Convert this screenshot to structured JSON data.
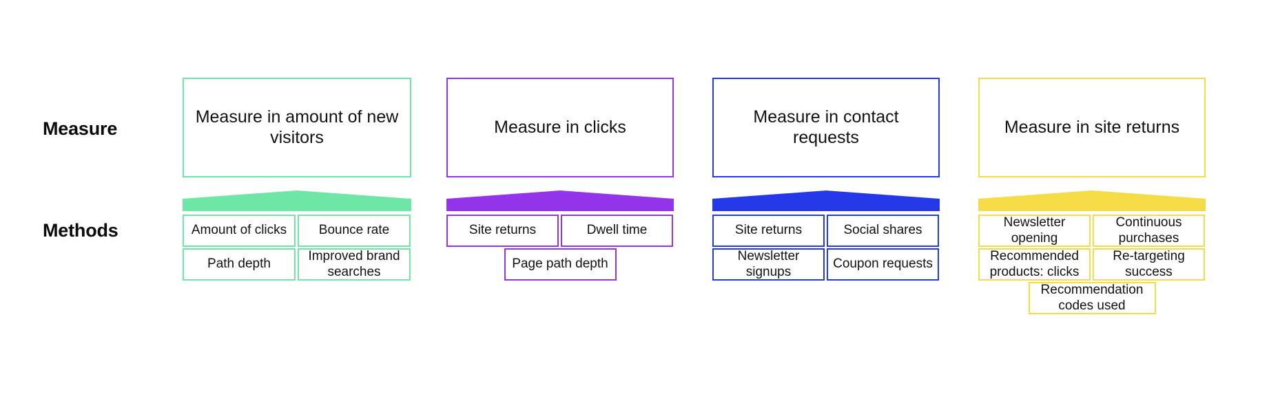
{
  "diagram": {
    "title": "Measure and Methods Funnel Diagram",
    "background_color": "#ffffff",
    "rows": {
      "measure_label": "Measure",
      "methods_label": "Methods"
    },
    "columns": [
      {
        "id": "new-visitors",
        "color": "#6EE7A6",
        "measure": "Measure in amount of new visitors",
        "arrow_icon": "funnel-chevron-icon",
        "method_rows": [
          {
            "centered": false,
            "boxes": [
              "Amount of clicks",
              "Bounce rate"
            ]
          },
          {
            "centered": false,
            "boxes": [
              "Path depth",
              "Improved brand searches"
            ]
          }
        ]
      },
      {
        "id": "clicks",
        "color": "#9333EA",
        "measure": "Measure in clicks",
        "arrow_icon": "funnel-chevron-icon",
        "method_rows": [
          {
            "centered": false,
            "boxes": [
              "Site returns",
              "Dwell time"
            ]
          },
          {
            "centered": true,
            "boxes": [
              "Page path depth"
            ]
          }
        ]
      },
      {
        "id": "contact-requests",
        "color": "#2538E8",
        "measure": "Measure in contact requests",
        "arrow_icon": "funnel-chevron-icon",
        "method_rows": [
          {
            "centered": false,
            "boxes": [
              "Site returns",
              "Social shares"
            ]
          },
          {
            "centered": false,
            "boxes": [
              "Newsletter signups",
              "Coupon requests"
            ]
          }
        ]
      },
      {
        "id": "site-returns",
        "color": "#F5DB45",
        "measure": "Measure in site returns",
        "arrow_icon": "funnel-chevron-icon",
        "method_rows": [
          {
            "centered": false,
            "boxes": [
              "Newsletter opening",
              "Continuous purchases"
            ]
          },
          {
            "centered": false,
            "boxes": [
              "Recommended products: clicks",
              "Re-targeting success"
            ]
          },
          {
            "centered": true,
            "boxes": [
              "Recommendation codes used"
            ]
          }
        ]
      }
    ]
  }
}
